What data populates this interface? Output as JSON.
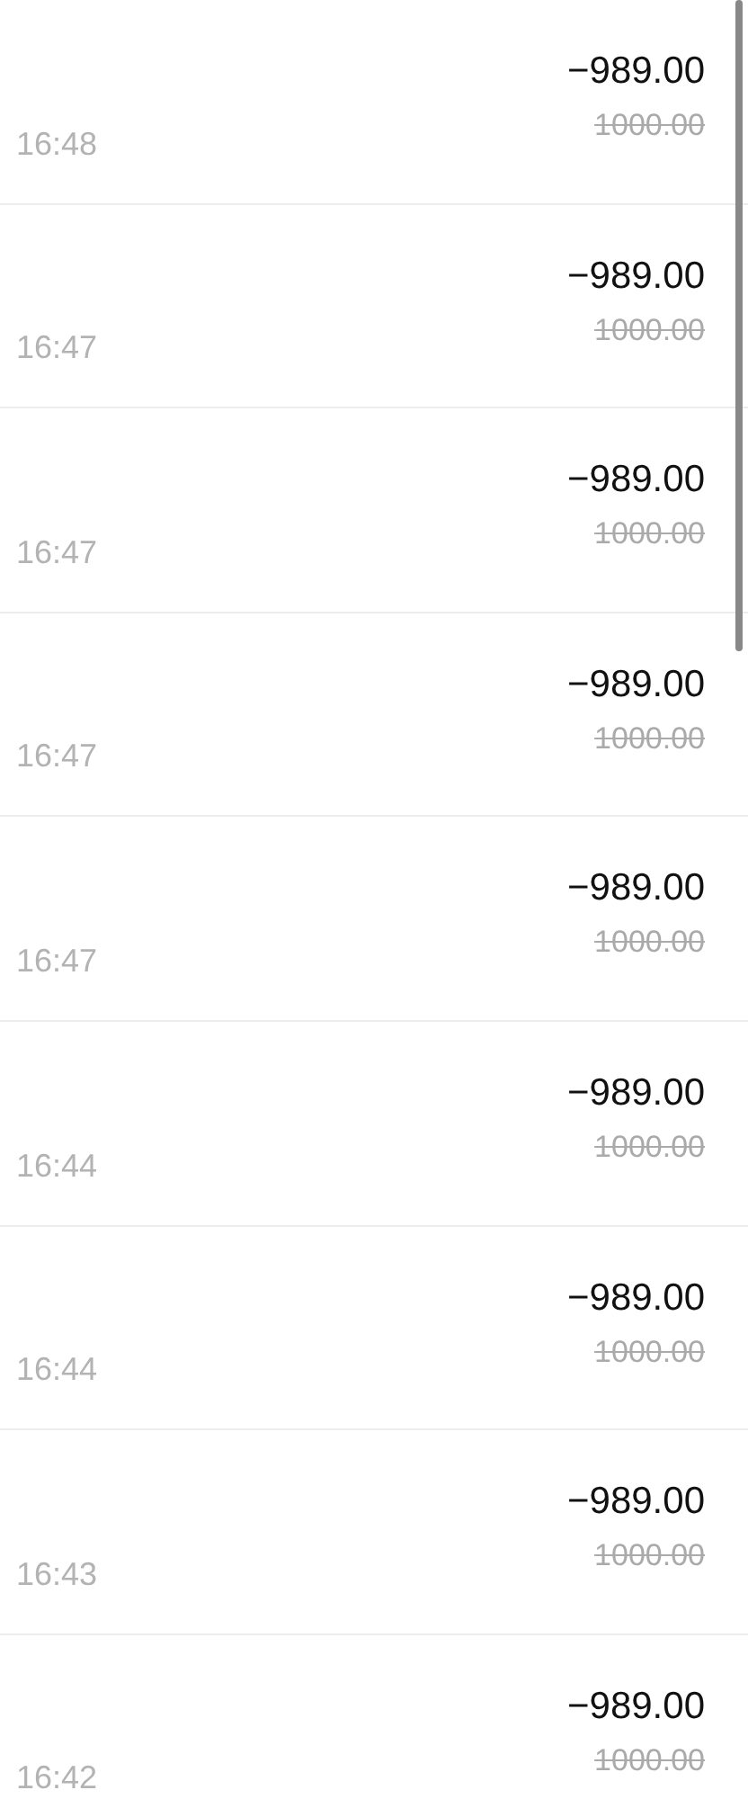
{
  "transactions": [
    {
      "time": "16:48",
      "amount": "−989.00",
      "original": "1000.00"
    },
    {
      "time": "16:47",
      "amount": "−989.00",
      "original": "1000.00"
    },
    {
      "time": "16:47",
      "amount": "−989.00",
      "original": "1000.00"
    },
    {
      "time": "16:47",
      "amount": "−989.00",
      "original": "1000.00"
    },
    {
      "time": "16:47",
      "amount": "−989.00",
      "original": "1000.00"
    },
    {
      "time": "16:44",
      "amount": "−989.00",
      "original": "1000.00"
    },
    {
      "time": "16:44",
      "amount": "−989.00",
      "original": "1000.00"
    },
    {
      "time": "16:43",
      "amount": "−989.00",
      "original": "1000.00"
    },
    {
      "time": "16:42",
      "amount": "−989.00",
      "original": "1000.00"
    }
  ]
}
